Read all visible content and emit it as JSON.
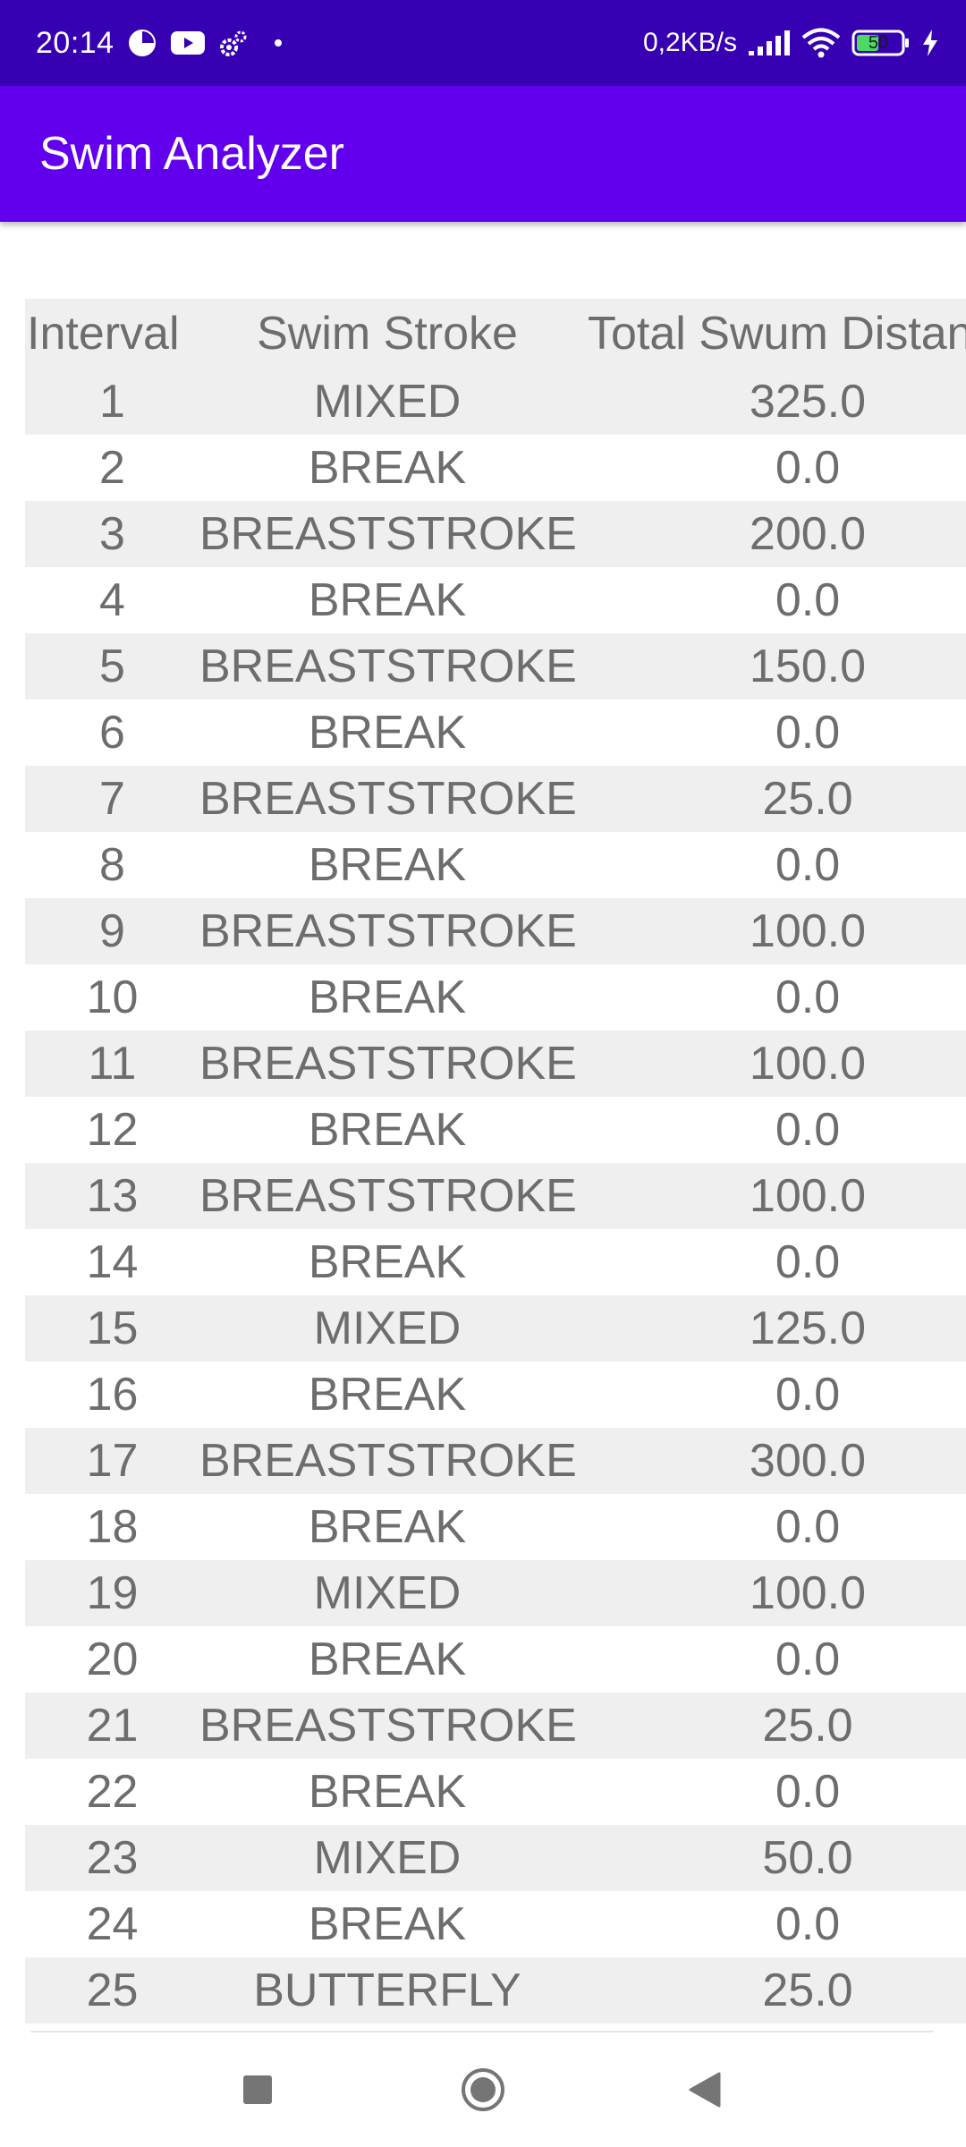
{
  "status_bar": {
    "time": "20:14",
    "net_speed": "0,2KB/s",
    "battery_level": "50",
    "icons": [
      "pie-icon",
      "youtube-icon",
      "settings-icon",
      "dot-icon",
      "signal-icon",
      "wifi-icon",
      "battery-icon",
      "charging-icon"
    ]
  },
  "app_bar": {
    "title": "Swim Analyzer"
  },
  "table": {
    "headers": [
      "Interval",
      "Swim Stroke",
      "Total Swum Distance"
    ],
    "rows": [
      [
        "1",
        "MIXED",
        "325.0"
      ],
      [
        "2",
        "BREAK",
        "0.0"
      ],
      [
        "3",
        "BREASTSTROKE",
        "200.0"
      ],
      [
        "4",
        "BREAK",
        "0.0"
      ],
      [
        "5",
        "BREASTSTROKE",
        "150.0"
      ],
      [
        "6",
        "BREAK",
        "0.0"
      ],
      [
        "7",
        "BREASTSTROKE",
        "25.0"
      ],
      [
        "8",
        "BREAK",
        "0.0"
      ],
      [
        "9",
        "BREASTSTROKE",
        "100.0"
      ],
      [
        "10",
        "BREAK",
        "0.0"
      ],
      [
        "11",
        "BREASTSTROKE",
        "100.0"
      ],
      [
        "12",
        "BREAK",
        "0.0"
      ],
      [
        "13",
        "BREASTSTROKE",
        "100.0"
      ],
      [
        "14",
        "BREAK",
        "0.0"
      ],
      [
        "15",
        "MIXED",
        "125.0"
      ],
      [
        "16",
        "BREAK",
        "0.0"
      ],
      [
        "17",
        "BREASTSTROKE",
        "300.0"
      ],
      [
        "18",
        "BREAK",
        "0.0"
      ],
      [
        "19",
        "MIXED",
        "100.0"
      ],
      [
        "20",
        "BREAK",
        "0.0"
      ],
      [
        "21",
        "BREASTSTROKE",
        "25.0"
      ],
      [
        "22",
        "BREAK",
        "0.0"
      ],
      [
        "23",
        "MIXED",
        "50.0"
      ],
      [
        "24",
        "BREAK",
        "0.0"
      ],
      [
        "25",
        "BUTTERFLY",
        "25.0"
      ]
    ]
  },
  "nav_bar": {
    "buttons": [
      "recents-button",
      "home-button",
      "back-button"
    ]
  },
  "colors": {
    "status_bar": "#3700b3",
    "app_bar": "#6200ee",
    "row_alt": "#efefef",
    "text": "#6d6d6d"
  }
}
